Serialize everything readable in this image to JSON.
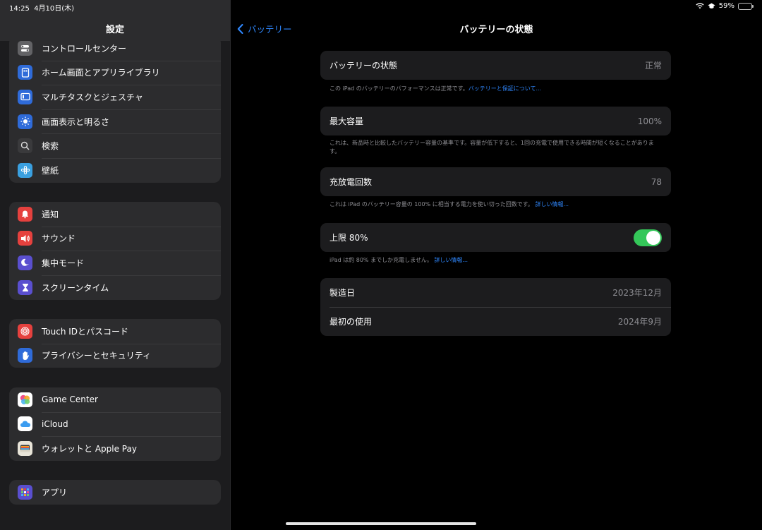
{
  "status": {
    "time": "14:25",
    "date": "4月10日(木)",
    "battery_percent": "59%",
    "battery_level": 0.59
  },
  "sidebar": {
    "title": "設定",
    "groups": [
      {
        "items": [
          {
            "label": "コントロールセンター",
            "icon": "control-center-icon",
            "color": "#636366"
          },
          {
            "label": "ホーム画面とアプリライブラリ",
            "icon": "home-screen-icon",
            "color": "#2f6bd9"
          },
          {
            "label": "マルチタスクとジェスチャ",
            "icon": "multitasking-icon",
            "color": "#2f6bd9"
          },
          {
            "label": "画面表示と明るさ",
            "icon": "brightness-icon",
            "color": "#2f6bd9"
          },
          {
            "label": "検索",
            "icon": "search-icon",
            "color": "#636366"
          },
          {
            "label": "壁紙",
            "icon": "wallpaper-icon",
            "color": "#3aa0e0"
          }
        ]
      },
      {
        "items": [
          {
            "label": "通知",
            "icon": "notifications-icon",
            "color": "#e5413e"
          },
          {
            "label": "サウンド",
            "icon": "sound-icon",
            "color": "#e5413e"
          },
          {
            "label": "集中モード",
            "icon": "focus-icon",
            "color": "#5a4fcf"
          },
          {
            "label": "スクリーンタイム",
            "icon": "screen-time-icon",
            "color": "#5a4fcf"
          }
        ]
      },
      {
        "items": [
          {
            "label": "Touch IDとパスコード",
            "icon": "touch-id-icon",
            "color": "#e5413e"
          },
          {
            "label": "プライバシーとセキュリティ",
            "icon": "privacy-hand-icon",
            "color": "#2f6bd9"
          }
        ]
      },
      {
        "items": [
          {
            "label": "Game Center",
            "icon": "game-center-icon",
            "color": "#ffffff"
          },
          {
            "label": "iCloud",
            "icon": "icloud-icon",
            "color": "#ffffff"
          },
          {
            "label": "ウォレットと Apple Pay",
            "icon": "wallet-icon",
            "color": "#3a3a3c"
          }
        ]
      },
      {
        "items": [
          {
            "label": "アプリ",
            "icon": "apps-icon",
            "color": "#5a4fcf"
          }
        ]
      }
    ]
  },
  "nav": {
    "back_label": "バッテリー",
    "title": "バッテリーの状態"
  },
  "battery_health": {
    "label": "バッテリーの状態",
    "value": "正常",
    "footnote": "この iPad のバッテリーのパフォーマンスは正常です。",
    "footnote_link": "バッテリーと保証について..."
  },
  "max_capacity": {
    "label": "最大容量",
    "value": "100%",
    "footnote": "これは、新品時と比較したバッテリー容量の基準です。容量が低下すると、1回の充電で使用できる時間が短くなることがあります。"
  },
  "cycle_count": {
    "label": "充放電回数",
    "value": "78",
    "footnote": "これは iPad のバッテリー容量の 100% に相当する電力を使い切った回数です。",
    "footnote_link": "詳しい情報..."
  },
  "limit": {
    "label": "上限 80%",
    "enabled": true,
    "footnote": "iPad は約 80% までしか充電しません。",
    "footnote_link": "詳しい情報..."
  },
  "info": {
    "manufacture_label": "製造日",
    "manufacture_value": "2023年12月",
    "first_use_label": "最初の使用",
    "first_use_value": "2024年9月"
  }
}
